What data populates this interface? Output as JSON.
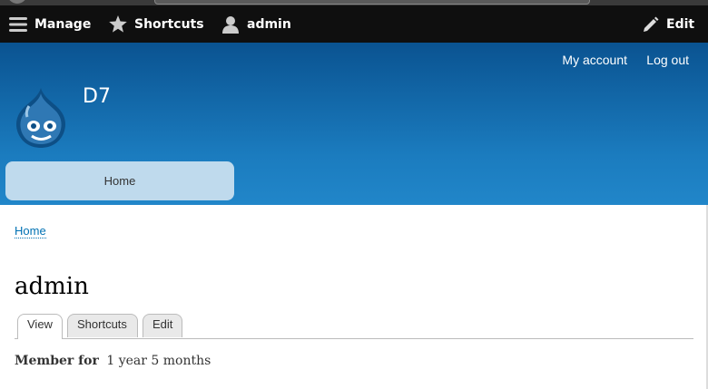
{
  "toolbar": {
    "manage_label": "Manage",
    "shortcuts_label": "Shortcuts",
    "user_label": "admin",
    "edit_label": "Edit"
  },
  "header": {
    "site_name": "D7",
    "secondary_menu": [
      "My account",
      "Log out"
    ],
    "main_menu": [
      "Home"
    ],
    "colors": {
      "gradient_top": "#0a5391",
      "gradient_bottom": "#2186c9",
      "menu_bg": "#bfdaed"
    }
  },
  "breadcrumb": "Home",
  "page": {
    "title": "admin",
    "tabs": [
      "View",
      "Shortcuts",
      "Edit"
    ],
    "active_tab": "View",
    "member_label": "Member for",
    "member_value": "1 year 5 months"
  },
  "icons": {
    "manage": "hamburger-icon",
    "shortcuts": "star-icon",
    "user": "person-icon",
    "edit": "pencil-icon",
    "logo": "drupal-drop-logo"
  }
}
